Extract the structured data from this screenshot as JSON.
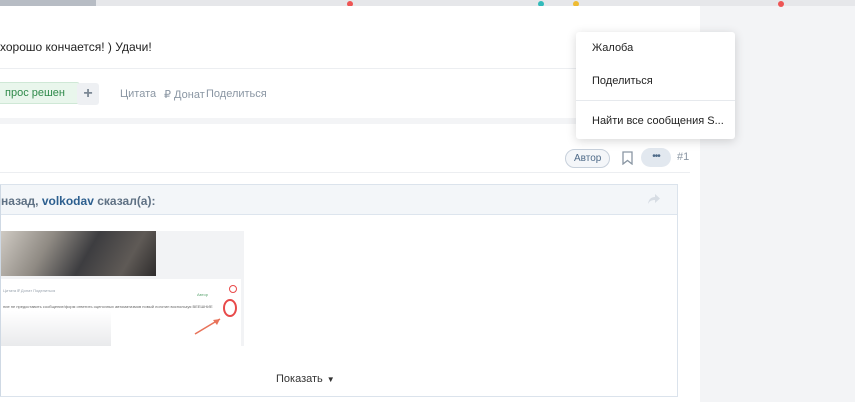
{
  "post1": {
    "text": "хорошо кончается! ) Удачи!",
    "solved_label": "прос решен",
    "plus_label": "+",
    "quote_label": "Цитата",
    "donate_label": "₽ Донат",
    "share_label": "Поделиться"
  },
  "post2": {
    "author_badge": "Автор",
    "more_label": "•••",
    "post_number": "#1"
  },
  "quote": {
    "prefix": "назад, ",
    "user": "volkodav",
    "suffix": " сказал(а):",
    "show_more_label": "Показать",
    "caret": "▼",
    "screenshot_text": {
      "line1": "Цитата  ₽ Донат  Поделиться",
      "line2": "Автор",
      "line3": "ние не предоставить сообщение/форм ответить оценочных автоматизмов новый логотип воспользуя ВЕЕШНИЕ"
    }
  },
  "menu": {
    "items": [
      "Жалоба",
      "Поделиться",
      "Найти все сообщения S..."
    ]
  },
  "colors": {
    "accent": "#2d5f8f",
    "solved_green": "#2f8a4a",
    "highlight_red": "#e84a4a"
  }
}
